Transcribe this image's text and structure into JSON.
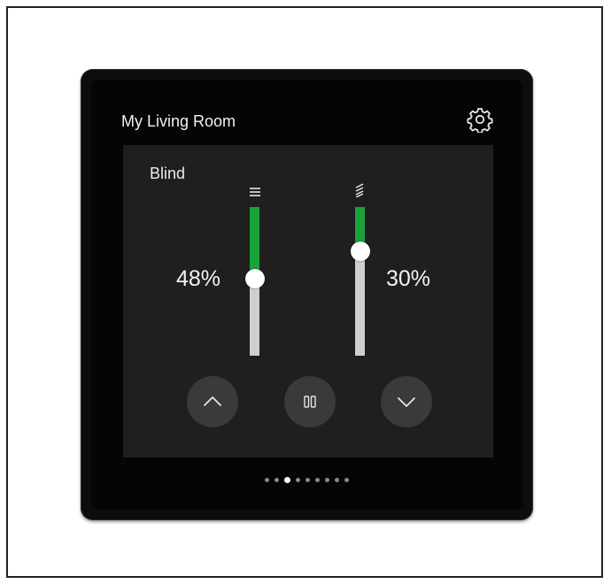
{
  "header": {
    "title": "My Living Room",
    "settings_icon": "gear-icon"
  },
  "card": {
    "title": "Blind",
    "position_slider": {
      "icon": "position-lines-icon",
      "value_label": "48%",
      "fill_fraction": 0.48
    },
    "tilt_slider": {
      "icon": "slat-tilt-icon",
      "value_label": "30%",
      "fill_fraction": 0.3
    },
    "buttons": [
      {
        "name": "up",
        "icon": "chevron-up-icon"
      },
      {
        "name": "stop",
        "icon": "pause-icon"
      },
      {
        "name": "down",
        "icon": "chevron-down-icon"
      }
    ]
  },
  "pagination": {
    "count": 9,
    "active_index": 2
  },
  "colors": {
    "accent": "#1aa33a",
    "track": "#cfcfcf",
    "card_bg": "#1f1f1f",
    "button_bg": "#3a3a3a",
    "screen_bg": "#050505"
  }
}
